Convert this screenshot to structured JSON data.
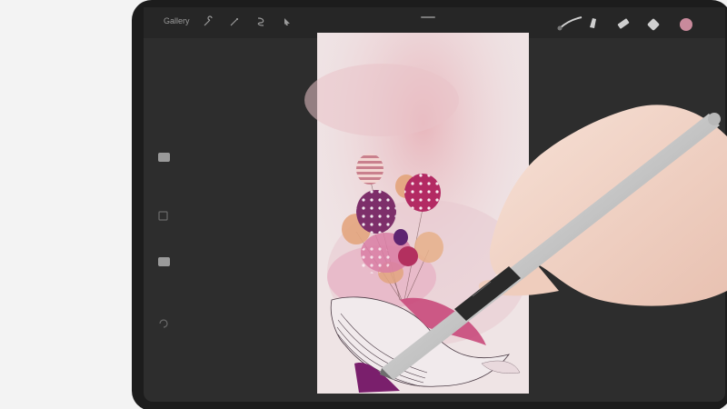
{
  "toolbar": {
    "gallery_label": "Gallery",
    "left_tools": [
      "wrench-icon",
      "magic-wand-icon",
      "selection-icon",
      "transform-arrow-icon"
    ],
    "right_tools": [
      "brush-icon",
      "smudge-icon",
      "eraser-icon",
      "layers-icon"
    ],
    "color_swatch": "#c98a9c"
  },
  "sidebar": {
    "controls": [
      "brush-size-slider",
      "modify-button",
      "opacity-slider",
      "undo-button"
    ]
  },
  "colors": {
    "ipad_frame": "#1c1c1c",
    "ui_background": "#2d2d2d",
    "canvas_paper": "#f2e8e9",
    "balloon_plum": "#7d2f6a",
    "balloon_magenta": "#b32a63",
    "balloon_peach": "#e4a883",
    "whale_pink": "#c94a7b"
  }
}
